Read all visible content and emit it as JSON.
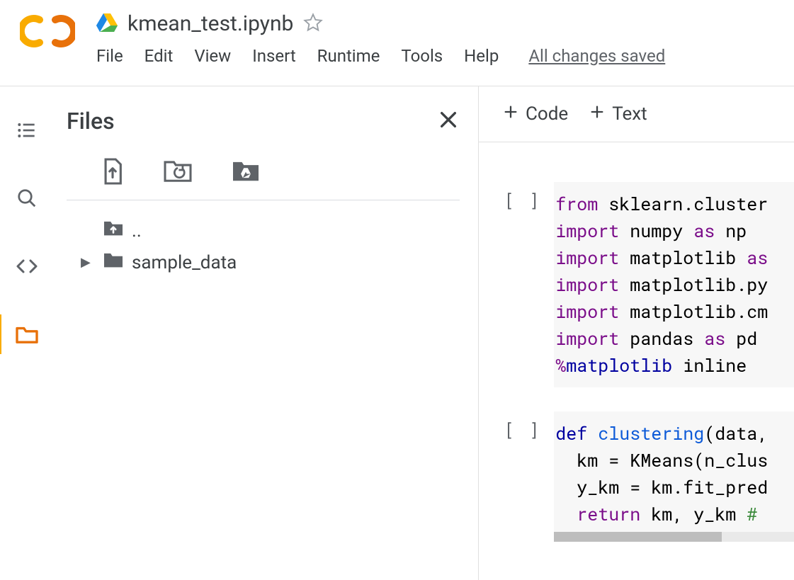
{
  "header": {
    "doc_title": "kmean_test.ipynb",
    "menu": {
      "file": "File",
      "edit": "Edit",
      "view": "View",
      "insert": "Insert",
      "runtime": "Runtime",
      "tools": "Tools",
      "help": "Help"
    },
    "save_status": "All changes saved"
  },
  "sidebar": {
    "title": "Files",
    "tree": {
      "parent": "..",
      "folder": "sample_data"
    }
  },
  "notebook": {
    "toolbar": {
      "code": "Code",
      "text": "Text"
    },
    "cells": [
      {
        "bracket": "[ ]",
        "lines": [
          [
            {
              "cls": "tok-kw2",
              "t": "from"
            },
            {
              "cls": "tok-text",
              "t": " sklearn.cluster"
            }
          ],
          [
            {
              "cls": "tok-kw2",
              "t": "import"
            },
            {
              "cls": "tok-text",
              "t": " numpy "
            },
            {
              "cls": "tok-kw2",
              "t": "as"
            },
            {
              "cls": "tok-text",
              "t": " np"
            }
          ],
          [
            {
              "cls": "tok-kw2",
              "t": "import"
            },
            {
              "cls": "tok-text",
              "t": " matplotlib "
            },
            {
              "cls": "tok-kw2",
              "t": "as"
            }
          ],
          [
            {
              "cls": "tok-kw2",
              "t": "import"
            },
            {
              "cls": "tok-text",
              "t": " matplotlib.py"
            }
          ],
          [
            {
              "cls": "tok-kw2",
              "t": "import"
            },
            {
              "cls": "tok-text",
              "t": " matplotlib.cm"
            }
          ],
          [
            {
              "cls": "tok-kw2",
              "t": "import"
            },
            {
              "cls": "tok-text",
              "t": " pandas "
            },
            {
              "cls": "tok-kw2",
              "t": "as"
            },
            {
              "cls": "tok-text",
              "t": " pd"
            }
          ],
          [
            {
              "cls": "tok-op",
              "t": "%"
            },
            {
              "cls": "tok-kw",
              "t": "matplotlib"
            },
            {
              "cls": "tok-text",
              "t": " inline"
            }
          ]
        ],
        "scrollbar": false
      },
      {
        "bracket": "[ ]",
        "lines": [
          [
            {
              "cls": "tok-kw",
              "t": "def"
            },
            {
              "cls": "tok-text",
              "t": " "
            },
            {
              "cls": "tok-fn",
              "t": "clustering"
            },
            {
              "cls": "tok-text",
              "t": "(data,"
            }
          ],
          [
            {
              "cls": "tok-text",
              "t": "  km = KMeans(n_clus"
            }
          ],
          [
            {
              "cls": "tok-text",
              "t": "  y_km = km.fit_pred"
            }
          ],
          [
            {
              "cls": "tok-text",
              "t": "  "
            },
            {
              "cls": "tok-kw2",
              "t": "return"
            },
            {
              "cls": "tok-text",
              "t": " km, y_km "
            },
            {
              "cls": "tok-comment",
              "t": "# "
            }
          ]
        ],
        "scrollbar": true
      }
    ]
  }
}
